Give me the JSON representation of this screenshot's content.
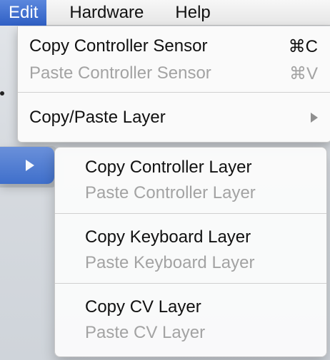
{
  "menubar": {
    "items": [
      {
        "label": "Edit",
        "active": true
      },
      {
        "label": "Hardware",
        "active": false
      },
      {
        "label": "Help",
        "active": false
      }
    ]
  },
  "menu": {
    "items": [
      {
        "label": "Copy Controller Sensor",
        "shortcut": "⌘C",
        "disabled": false
      },
      {
        "label": "Paste Controller Sensor",
        "shortcut": "⌘V",
        "disabled": true
      },
      {
        "label": "Copy/Paste Layer",
        "submenu": true,
        "disabled": false
      }
    ]
  },
  "submenu": {
    "items": [
      {
        "label": "Copy Controller Layer",
        "disabled": false
      },
      {
        "label": "Paste Controller Layer",
        "disabled": true
      },
      {
        "label": "Copy Keyboard Layer",
        "disabled": false
      },
      {
        "label": "Paste Keyboard Layer",
        "disabled": true
      },
      {
        "label": "Copy CV Layer",
        "disabled": false
      },
      {
        "label": "Paste CV Layer",
        "disabled": true
      }
    ]
  },
  "colors": {
    "menu_highlight": "#3f6fcb",
    "disabled_text": "#a3a3a3"
  },
  "icons": {
    "submenu_arrow": "triangle-right-icon",
    "parent_arrow": "triangle-right-icon"
  }
}
